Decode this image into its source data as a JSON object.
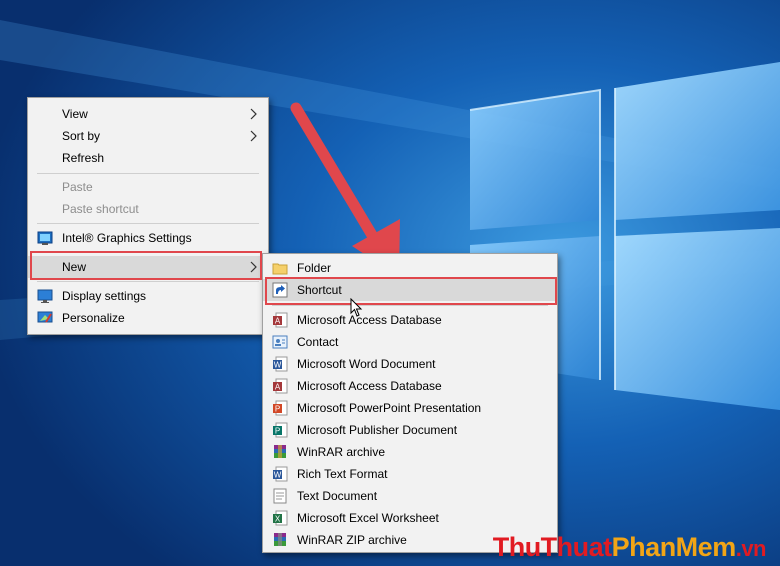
{
  "context_menu": {
    "items": [
      {
        "label": "View",
        "submenu": true,
        "enabled": true
      },
      {
        "label": "Sort by",
        "submenu": true,
        "enabled": true
      },
      {
        "label": "Refresh",
        "submenu": false,
        "enabled": true
      },
      {
        "label": "Paste",
        "submenu": false,
        "enabled": false
      },
      {
        "label": "Paste shortcut",
        "submenu": false,
        "enabled": false
      },
      {
        "label": "Intel® Graphics Settings",
        "submenu": false,
        "enabled": true,
        "icon": "intel-graphics-icon"
      },
      {
        "label": "New",
        "submenu": true,
        "enabled": true,
        "highlighted": true
      },
      {
        "label": "Display settings",
        "submenu": false,
        "enabled": true,
        "icon": "display-icon"
      },
      {
        "label": "Personalize",
        "submenu": false,
        "enabled": true,
        "icon": "personalize-icon"
      }
    ]
  },
  "new_submenu": {
    "items": [
      {
        "label": "Folder",
        "icon": "folder-icon"
      },
      {
        "label": "Shortcut",
        "icon": "shortcut-icon",
        "highlighted": true
      },
      {
        "label": "Microsoft Access Database",
        "icon": "access-icon"
      },
      {
        "label": "Contact",
        "icon": "contact-icon"
      },
      {
        "label": "Microsoft Word Document",
        "icon": "word-icon"
      },
      {
        "label": "Microsoft Access Database",
        "icon": "access-icon"
      },
      {
        "label": "Microsoft PowerPoint Presentation",
        "icon": "powerpoint-icon"
      },
      {
        "label": "Microsoft Publisher Document",
        "icon": "publisher-icon"
      },
      {
        "label": "WinRAR archive",
        "icon": "winrar-icon"
      },
      {
        "label": "Rich Text Format",
        "icon": "rtf-icon"
      },
      {
        "label": "Text Document",
        "icon": "text-document-icon"
      },
      {
        "label": "Microsoft Excel Worksheet",
        "icon": "excel-icon"
      },
      {
        "label": "WinRAR ZIP archive",
        "icon": "winrar-zip-icon"
      }
    ]
  },
  "watermark": {
    "part1": "ThuThuat",
    "part2": "PhanMem",
    "part3": ".vn"
  },
  "colors": {
    "annotation_red": "#e0474c",
    "desktop_blue": "#0b3f86",
    "menu_bg": "#f2f2f2",
    "highlight": "#d9d9d9"
  }
}
